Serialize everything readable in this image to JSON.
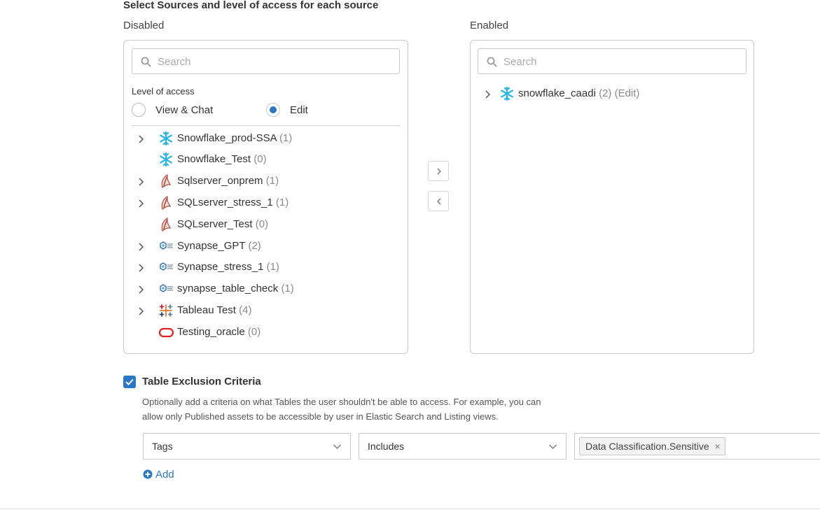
{
  "heading": "Select Sources and level of access for each source",
  "disabled_panel": {
    "label": "Disabled",
    "search_placeholder": "Search",
    "level_label": "Level of access",
    "radio_view_chat": "View & Chat",
    "radio_edit": "Edit",
    "selected_level": "Edit",
    "sources": [
      {
        "name": "Snowflake_prod-SSA",
        "count": "(1)",
        "icon": "snowflake-icon",
        "expandable": true
      },
      {
        "name": "Snowflake_Test",
        "count": "(0)",
        "icon": "snowflake-icon",
        "expandable": false
      },
      {
        "name": "Sqlserver_onprem",
        "count": "(1)",
        "icon": "sqlserver-icon",
        "expandable": true
      },
      {
        "name": "SQLserver_stress_1",
        "count": "(1)",
        "icon": "sqlserver-icon",
        "expandable": true
      },
      {
        "name": "SQLserver_Test",
        "count": "(0)",
        "icon": "sqlserver-icon",
        "expandable": false
      },
      {
        "name": "Synapse_GPT",
        "count": "(2)",
        "icon": "synapse-icon",
        "expandable": true
      },
      {
        "name": "Synapse_stress_1",
        "count": "(1)",
        "icon": "synapse-icon",
        "expandable": true
      },
      {
        "name": "synapse_table_check",
        "count": "(1)",
        "icon": "synapse-icon",
        "expandable": true
      },
      {
        "name": "Tableau Test",
        "count": "(4)",
        "icon": "tableau-icon",
        "expandable": true
      },
      {
        "name": "Testing_oracle",
        "count": "(0)",
        "icon": "oracle-icon",
        "expandable": false
      }
    ]
  },
  "enabled_panel": {
    "label": "Enabled",
    "search_placeholder": "Search",
    "sources": [
      {
        "name": "snowflake_caadi",
        "suffix": "(2) (Edit)",
        "icon": "snowflake-icon",
        "expandable": true
      }
    ]
  },
  "transfer": {
    "move_right_icon": "chevron-right-icon",
    "move_left_icon": "chevron-left-icon"
  },
  "criteria": {
    "checked": true,
    "title": "Table Exclusion Criteria",
    "description_line1": "Optionally add a criteria on what Tables the user shouldn't be able to access. For example, you can",
    "description_line2": "allow only Published assets to be accessible by user in Elastic Search and Listing views.",
    "field_select": "Tags",
    "operator_select": "Includes",
    "tag_value": "Data Classification.Sensitive",
    "tag_remove": "×",
    "add_label": "Add"
  },
  "colors": {
    "accent": "#2a77c4",
    "snowflake": "#29b5e8",
    "oracle": "#e0201b",
    "border": "#c9c9c9"
  }
}
